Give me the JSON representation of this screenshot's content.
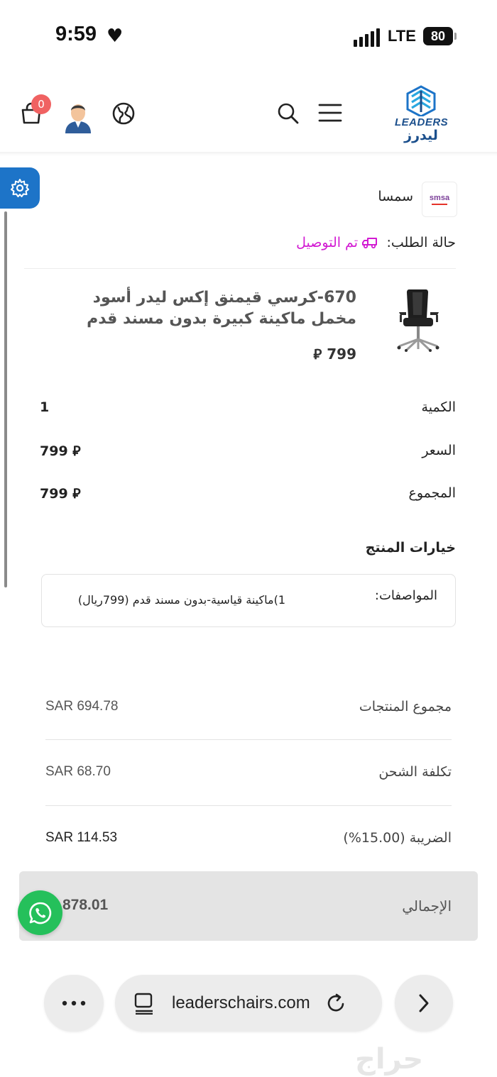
{
  "status_bar": {
    "time": "9:59",
    "network": "LTE",
    "battery": "80"
  },
  "header": {
    "cart_count": "0",
    "logo_en": "LEADERS",
    "logo_ar": "ليدرز"
  },
  "shipping": {
    "carrier_logo": "smsa",
    "carrier_name": "سمسا",
    "status_label": "حالة الطلب:",
    "status_value": "تم التوصيل"
  },
  "product": {
    "title": "670-كرسي قيمنق إكس ليدر أسود مخمل ماكينة كبيرة بدون مسند قدم",
    "price": "799 ⃁"
  },
  "details": [
    {
      "label": "الكمية",
      "value": "1"
    },
    {
      "label": "السعر",
      "value": "799 ⃁"
    },
    {
      "label": "المجموع",
      "value": "799 ⃁"
    }
  ],
  "options": {
    "title": "خيارات المنتج",
    "spec_label": "المواصفات:",
    "spec_value": "1)ماكينة قياسية-بدون مسند قدم (799ريال)"
  },
  "totals": [
    {
      "label": "مجموع المنتجات",
      "value": "SAR 694.78"
    },
    {
      "label": "تكلفة الشحن",
      "value": "SAR 68.70"
    },
    {
      "label": "الضريبة (15.00%)",
      "value": "SAR 114.53"
    }
  ],
  "grand_total": {
    "label": "الإجمالي",
    "value": "878.01"
  },
  "browser": {
    "url": "leaderschairs.com"
  },
  "watermark": "حراج",
  "colors": {
    "accent": "#1d74c8",
    "delivered": "#d21ad2",
    "whatsapp": "#25c05b",
    "badge": "#f06262"
  }
}
